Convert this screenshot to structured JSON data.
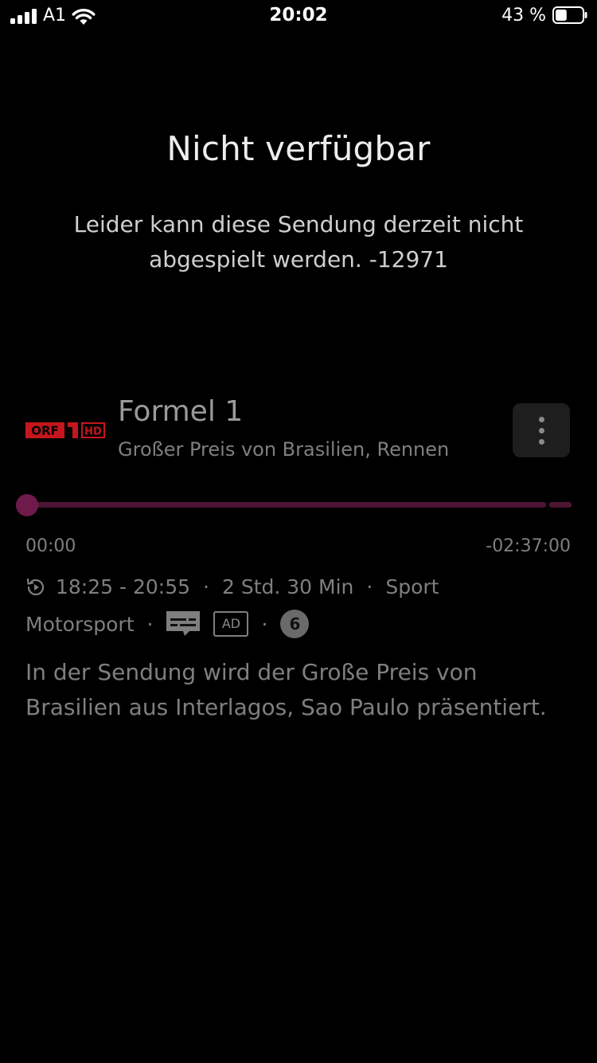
{
  "status_bar": {
    "carrier": "A1",
    "time": "20:02",
    "battery_percent": "43 %",
    "battery_level": 0.43,
    "signal_bars": 4
  },
  "error": {
    "title": "Nicht verfügbar",
    "message": "Leider kann diese Sendung derzeit nicht abgespielt werden. -12971"
  },
  "program": {
    "channel_logo": {
      "icon": "orf1-hd-logo",
      "text": "ORF 1 HD",
      "color": "#c5161d"
    },
    "title": "Formel 1",
    "subtitle": "Großer Preis von Brasilien, Rennen",
    "more_icon": "more-vertical-icon"
  },
  "player": {
    "progress": 0.0,
    "elapsed": "00:00",
    "remaining": "-02:37:00",
    "accent_color": "#6e1a4a"
  },
  "meta": {
    "airtime": "18:25 - 20:55",
    "duration": "2 Std. 30 Min",
    "genre": "Sport",
    "subgenre": "Motorsport",
    "separator": "·",
    "audio_description": "AD",
    "age_rating": "6",
    "replay_icon": "replay-icon",
    "subtitles_icon": "subtitles-icon"
  },
  "description": "In der Sendung wird der Große Preis von Brasilien aus Interlagos, Sao Paulo präsentiert."
}
